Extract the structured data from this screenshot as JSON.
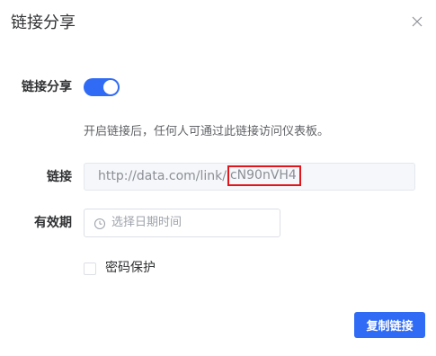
{
  "dialog": {
    "title": "链接分享",
    "close_icon": "close-icon"
  },
  "form": {
    "share_label": "链接分享",
    "share_enabled": true,
    "hint": "开启链接后，任何人可通过此链接访问仪表板。",
    "link_label": "链接",
    "link_prefix": "http://data.com/link/",
    "link_code": "cN90nVH4",
    "expiry_label": "有效期",
    "expiry_placeholder": "选择日期时间",
    "expiry_icon": "clock-icon",
    "password_label": "密码保护",
    "password_checked": false
  },
  "actions": {
    "copy_label": "复制链接"
  },
  "colors": {
    "primary": "#2f6bf5",
    "highlight_border": "#e0161c"
  }
}
